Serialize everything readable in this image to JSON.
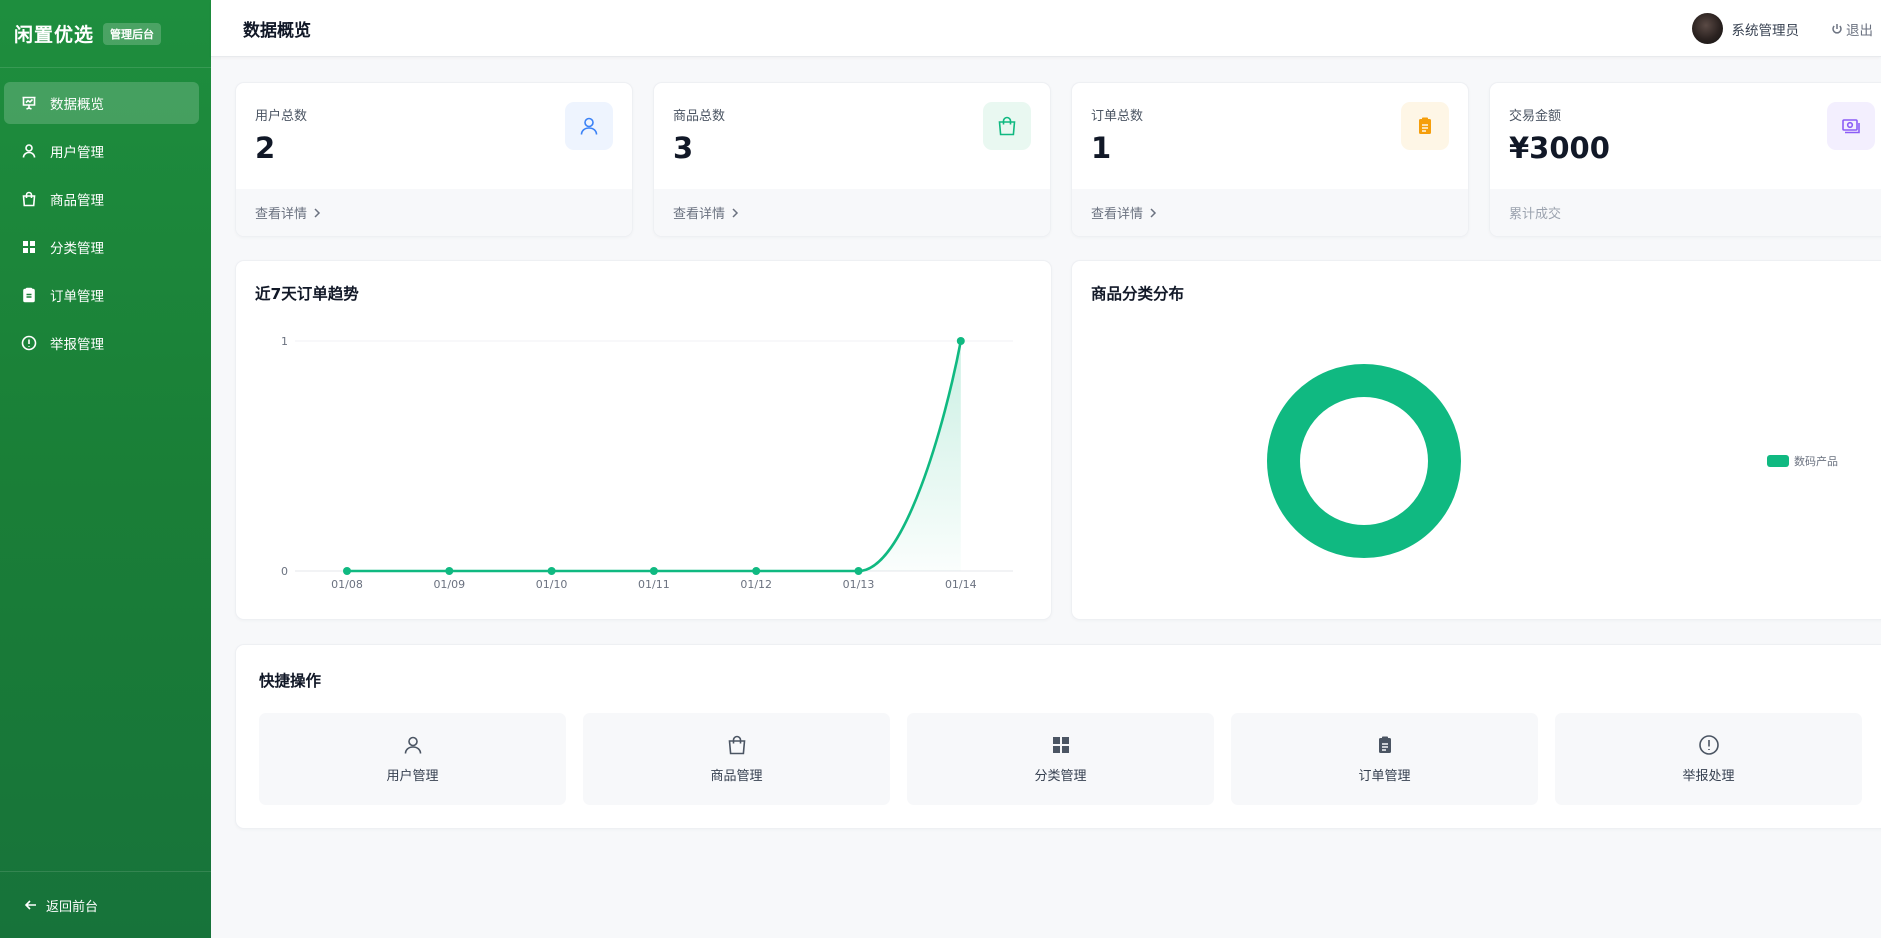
{
  "app": {
    "title": "闲置优选",
    "tag": "管理后台"
  },
  "sidebar": {
    "items": [
      {
        "label": "数据概览",
        "icon": "presentation-chart-icon",
        "active": true
      },
      {
        "label": "用户管理",
        "icon": "user-icon"
      },
      {
        "label": "商品管理",
        "icon": "shopping-bag-icon"
      },
      {
        "label": "分类管理",
        "icon": "grid-icon"
      },
      {
        "label": "订单管理",
        "icon": "clipboard-icon"
      },
      {
        "label": "举报管理",
        "icon": "alert-circle-icon"
      }
    ],
    "back_label": "返回前台"
  },
  "header": {
    "page_title": "数据概览",
    "user_name": "系统管理员",
    "logout_label": "退出"
  },
  "stats": [
    {
      "label": "用户总数",
      "value": "2",
      "footer": "查看详情",
      "icon": "user-icon",
      "color": "#3b82f6",
      "bg": "#eef4fe"
    },
    {
      "label": "商品总数",
      "value": "3",
      "footer": "查看详情",
      "icon": "shopping-bag-icon",
      "color": "#10b981",
      "bg": "#e9f8f1"
    },
    {
      "label": "订单总数",
      "value": "1",
      "footer": "查看详情",
      "icon": "clipboard-icon",
      "color": "#f59e0b",
      "bg": "#fef6e6"
    },
    {
      "label": "交易金额",
      "value": "¥3000",
      "footer": "累计成交",
      "icon": "money-icon",
      "color": "#8b5cf6",
      "bg": "#f3effe"
    }
  ],
  "trend": {
    "title": "近7天订单趋势",
    "chart_data": {
      "type": "area",
      "x": [
        "01/08",
        "01/09",
        "01/10",
        "01/11",
        "01/12",
        "01/13",
        "01/14"
      ],
      "series": [
        {
          "values": [
            0,
            0,
            0,
            0,
            0,
            0,
            1
          ]
        }
      ],
      "yticks": [
        "0",
        "1"
      ],
      "ylim": [
        0,
        1
      ],
      "color": "#10b981",
      "grid": true
    }
  },
  "distribution": {
    "title": "商品分类分布",
    "chart_data": {
      "type": "pie",
      "categories": [
        "数码产品"
      ],
      "values": [
        3
      ],
      "color": "#10b981",
      "legend": "right"
    }
  },
  "quick_actions": {
    "title": "快捷操作",
    "items": [
      {
        "label": "用户管理",
        "icon": "user-icon"
      },
      {
        "label": "商品管理",
        "icon": "shopping-bag-icon"
      },
      {
        "label": "分类管理",
        "icon": "grid-icon"
      },
      {
        "label": "订单管理",
        "icon": "clipboard-icon"
      },
      {
        "label": "举报处理",
        "icon": "alert-circle-icon"
      }
    ]
  }
}
